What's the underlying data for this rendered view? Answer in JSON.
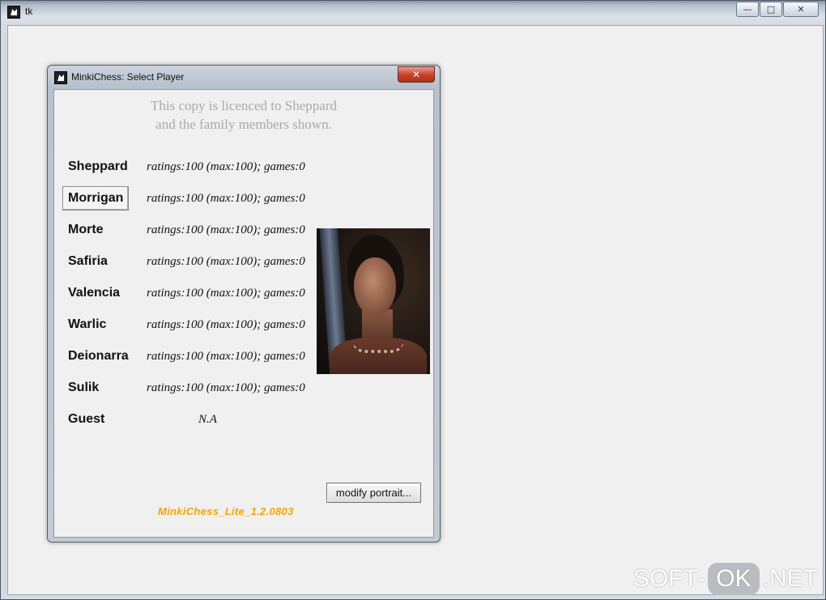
{
  "outer_window": {
    "title": "tk",
    "minimize_glyph": "—",
    "maximize_glyph": "□",
    "close_glyph": "✕"
  },
  "dialog": {
    "title": "MinkiChess: Select Player",
    "close_glyph": "✕",
    "licence_line1": "This copy is licenced to Sheppard",
    "licence_line2": "and the family members shown.",
    "players": [
      {
        "name": "Sheppard",
        "stats": "ratings:100 (max:100); games:0"
      },
      {
        "name": "Morrigan",
        "stats": "ratings:100 (max:100); games:0"
      },
      {
        "name": "Morte",
        "stats": "ratings:100 (max:100); games:0"
      },
      {
        "name": "Safiria",
        "stats": "ratings:100 (max:100); games:0"
      },
      {
        "name": "Valencia",
        "stats": "ratings:100 (max:100); games:0"
      },
      {
        "name": "Warlic",
        "stats": "ratings:100 (max:100); games:0"
      },
      {
        "name": "Deionarra",
        "stats": "ratings:100 (max:100); games:0"
      },
      {
        "name": "Sulik",
        "stats": "ratings:100 (max:100); games:0"
      },
      {
        "name": "Guest",
        "stats": "N.A"
      }
    ],
    "selected_player": "Morrigan",
    "modify_button": "modify portrait...",
    "version": "MinkiChess_Lite_1.2.0803"
  },
  "watermark": {
    "left": "SOFT-",
    "pill": "OK",
    "right": ".NET"
  },
  "colors": {
    "version_text": "#f5a300",
    "licence_text": "#a9a9a9",
    "close_button": "#c8442c"
  }
}
